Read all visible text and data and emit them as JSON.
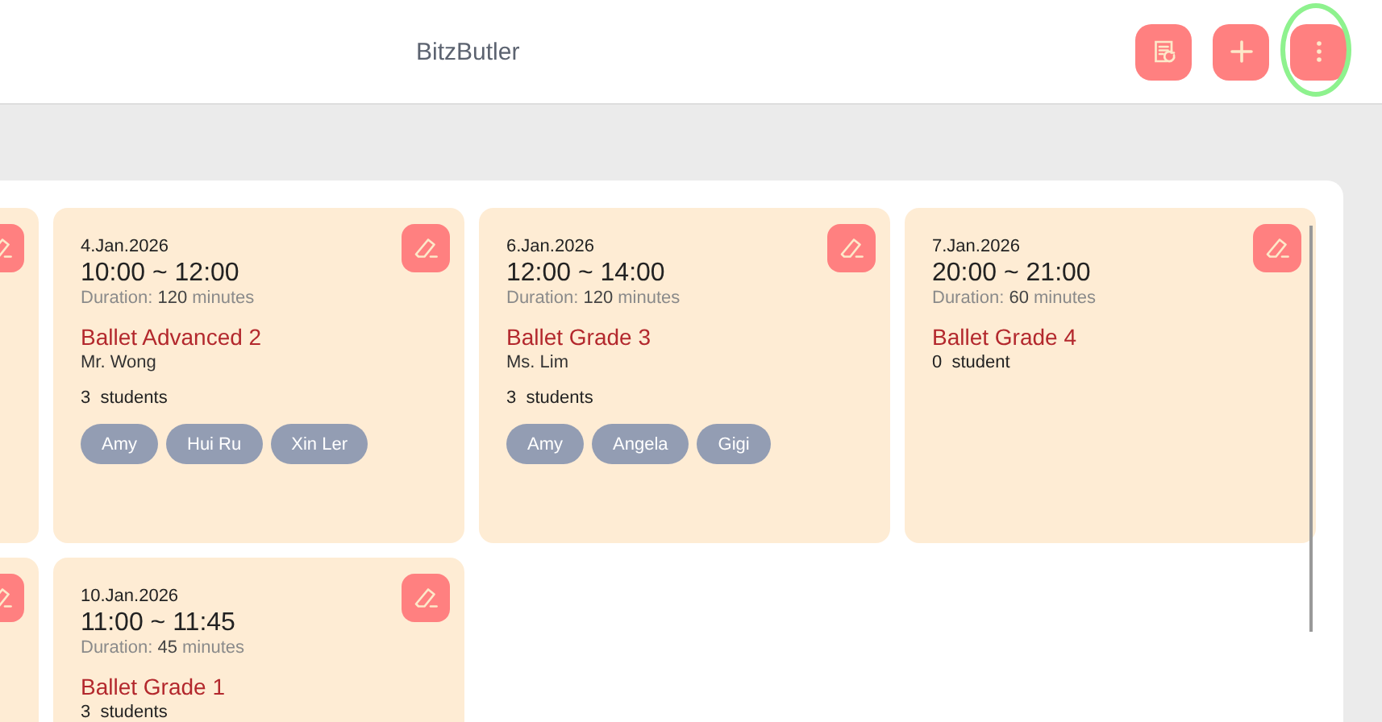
{
  "header": {
    "title": "BitzButler",
    "actions": [
      {
        "kind": "history"
      },
      {
        "kind": "add"
      },
      {
        "kind": "more",
        "highlighted": true
      }
    ]
  },
  "rows": [
    {
      "cards": [
        {
          "kind": "clipped"
        },
        {
          "kind": "full",
          "date": "4.Jan.2026",
          "time": "10:00 ~ 12:00",
          "duration_label": "Duration:",
          "duration": "120",
          "duration_unit": "minutes",
          "class_name": "Ballet Advanced 2",
          "teacher": "Mr. Wong",
          "count": "3",
          "count_unit": "students",
          "students": [
            "Amy",
            "Hui Ru",
            "Xin Ler"
          ]
        },
        {
          "kind": "full",
          "date": "6.Jan.2026",
          "time": "12:00 ~ 14:00",
          "duration_label": "Duration:",
          "duration": "120",
          "duration_unit": "minutes",
          "class_name": "Ballet Grade 3",
          "teacher": "Ms. Lim",
          "count": "3",
          "count_unit": "students",
          "students": [
            "Amy",
            "Angela",
            "Gigi"
          ]
        },
        {
          "kind": "full",
          "date": "7.Jan.2026",
          "time": "20:00 ~ 21:00",
          "duration_label": "Duration:",
          "duration": "60",
          "duration_unit": "minutes",
          "class_name": "Ballet Grade 4",
          "count": "0",
          "count_unit": "student"
        }
      ]
    },
    {
      "cards": [
        {
          "kind": "clipped"
        },
        {
          "kind": "full",
          "date": "10.Jan.2026",
          "time": "11:00 ~ 11:45",
          "duration_label": "Duration:",
          "duration": "45",
          "duration_unit": "minutes",
          "class_name": "Ballet Grade 1",
          "count": "3",
          "count_unit": "students"
        }
      ]
    }
  ]
}
